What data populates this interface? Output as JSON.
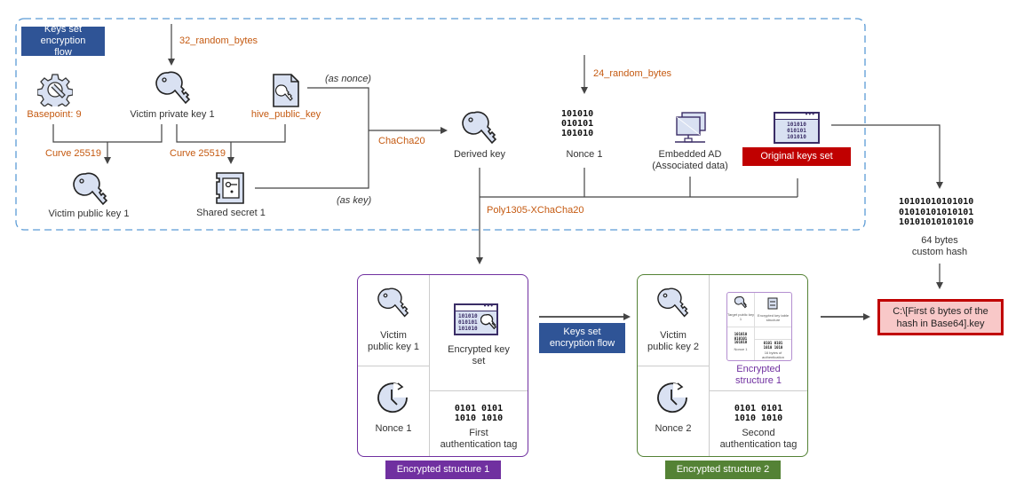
{
  "diagram": {
    "colors": {
      "orange_label": "#c55a11",
      "flow_badge": "#2f5496",
      "original_keys_badge": "#c00000",
      "structure1": "#7030a0",
      "structure2": "#548235",
      "dashed_border": "#5b9bd5",
      "icon_fill": "#d9e1f2",
      "file_box_fill": "#f8c8c8"
    },
    "top_section": {
      "badge": "Keys set encryption flow",
      "random_bytes_32": "32_random_bytes",
      "random_bytes_24": "24_random_bytes",
      "basepoint": "Basepoint: 9",
      "victim_private_key": "Victim private key 1",
      "hive_public_key": "hive_public_key",
      "curve_left": "Curve 25519",
      "curve_right": "Curve 25519",
      "victim_public_key": "Victim public key 1",
      "shared_secret": "Shared secret 1",
      "as_nonce": "(as nonce)",
      "as_key": "(as key)",
      "chacha20": "ChaCha20",
      "derived_key": "Derived key",
      "nonce": "Nonce 1",
      "nonce_binary": "101010\n010101\n101010",
      "embedded_ad_line1": "Embedded AD",
      "embedded_ad_line2": "(Associated data)",
      "original_keys_set": "Original keys set",
      "original_keys_binary": "101010\n010101\n101010",
      "poly1305": "Poly1305-XChaCha20"
    },
    "hash": {
      "binary": "10101010101010\n01010101010101\n10101010101010",
      "label_line1": "64 bytes",
      "label_line2": "custom hash"
    },
    "structure1": {
      "title": "Encrypted structure 1",
      "public_key_line1": "Victim",
      "public_key_line2": "public key 1",
      "encrypted_key_set_line1": "Encrypted key",
      "encrypted_key_set_line2": "set",
      "nonce": "Nonce 1",
      "tag_binary": "0101 0101\n1010 1010",
      "tag_line1": "First",
      "tag_line2": "authentication tag"
    },
    "middle_badge": "Keys set encryption flow",
    "structure2": {
      "title": "Encrypted structure 2",
      "public_key_line1": "Victim",
      "public_key_line2": "public key 2",
      "inner_title_line1": "Encrypted",
      "inner_title_line2": "structure 1",
      "inner_target_key": "Target public key 1",
      "inner_table": "Encrypted key table structure",
      "inner_nonce": "Nonce 1",
      "inner_auth": "16 bytes of authentication",
      "nonce": "Nonce 2",
      "tag_binary": "0101 0101\n1010 1010",
      "tag_line1": "Second",
      "tag_line2": "authentication tag"
    },
    "output_file": {
      "line1": "C:\\[First 6 bytes of the",
      "line2": "hash in Base64].key"
    }
  }
}
